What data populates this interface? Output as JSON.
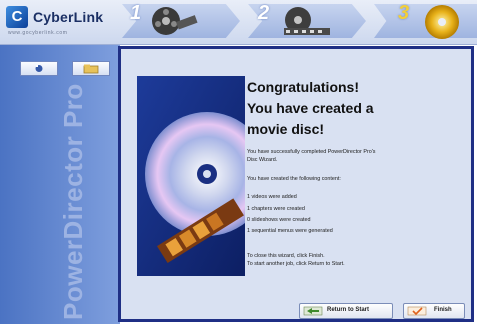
{
  "header": {
    "brand": "CyberLink",
    "brand_url": "www.gocyberlink.com",
    "steps": [
      {
        "number": "1",
        "icon": "film-reel-icon"
      },
      {
        "number": "2",
        "icon": "film-reel-icon"
      },
      {
        "number": "3",
        "icon": "disc-icon"
      }
    ]
  },
  "sidebar": {
    "vertical_brand": "PowerDirector Pro"
  },
  "wizard": {
    "title_lines": [
      "Congratulations!",
      "You have created a",
      "movie disc!"
    ],
    "intro_lines": [
      "You have successfully completed PowerDirector Pro's",
      "Disc Wizard."
    ],
    "created_heading": "You have created the following content:",
    "created_items": [
      "1 videos were added",
      "1 chapters were created",
      "0 slideshows were created",
      "1 sequential menus were generated"
    ],
    "instructions": [
      "To close this wizard, click Finish.",
      "To start another job, click Return to Start."
    ],
    "buttons": {
      "return_label": "Return to Start",
      "finish_label": "Finish"
    }
  },
  "colors": {
    "wizard_border": "#1f2f85",
    "wizard_background": "#d9e1f2",
    "sidebar_blue": "#4b73c3"
  }
}
